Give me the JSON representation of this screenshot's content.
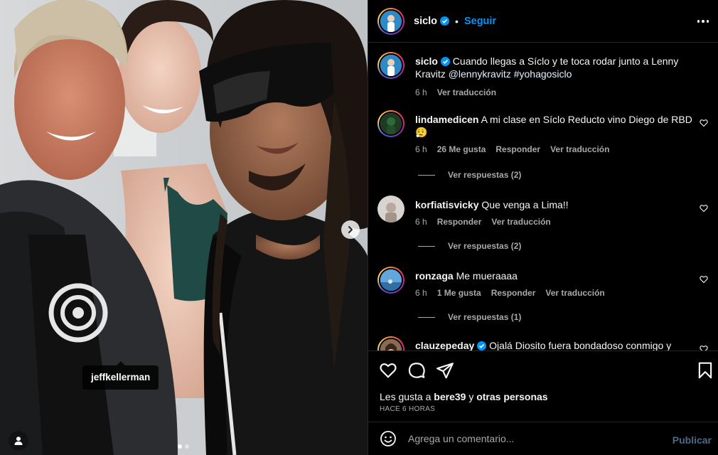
{
  "post": {
    "author": "siclo",
    "follow_label": "Seguir",
    "separator": "•",
    "caption": {
      "username": "siclo",
      "text_before": " Cuando llegas a Síclo y te toca rodar junto a Lenny Kravitz ",
      "mention": "@lennykravitz",
      "hashtag": "#yohagosiclo",
      "time": "6 h",
      "translate": "Ver traducción"
    },
    "photo": {
      "tagged_user": "jeffkellerman",
      "carousel_total": 2,
      "carousel_current": 1
    }
  },
  "comments": [
    {
      "username": "lindamedicen",
      "text": "A mi clase en Síclo Reducto vino Diego de RBD 😮‍💨",
      "time": "6 h",
      "likes": "26 Me gusta",
      "reply": "Responder",
      "translate": "Ver traducción",
      "replies": "Ver respuestas (2)"
    },
    {
      "username": "korfiatisvicky",
      "text": "Que venga a Lima!!",
      "time": "6 h",
      "reply": "Responder",
      "translate": "Ver traducción",
      "replies": "Ver respuestas (2)"
    },
    {
      "username": "ronzaga",
      "text": "Me mueraaaa",
      "time": "6 h",
      "likes": "1 Me gusta",
      "reply": "Responder",
      "translate": "Ver traducción",
      "replies": "Ver respuestas (1)"
    },
    {
      "username": "clauzepeday",
      "text": "Ojalá Diosito fuera bondadoso conmigo y"
    }
  ],
  "actions": {
    "likes_prefix": "Les gusta a ",
    "likes_user": "bere39",
    "likes_middle": " y ",
    "likes_others": "otras personas",
    "time_ago": "HACE 6 HORAS"
  },
  "compose": {
    "placeholder": "Agrega un comentario...",
    "publish": "Publicar"
  },
  "colors": {
    "link": "#0095f6",
    "verified": "#0095f6",
    "background": "#000000"
  },
  "icons": [
    "verified-icon",
    "more-options-icon",
    "heart-icon",
    "comment-icon",
    "share-icon",
    "bookmark-icon",
    "emoji-icon",
    "user-tag-icon",
    "chevron-right-icon"
  ]
}
